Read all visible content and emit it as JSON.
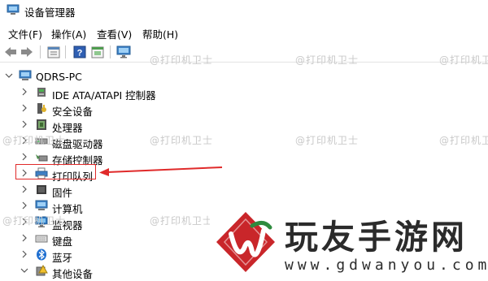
{
  "window": {
    "title": "设备管理器"
  },
  "menu": [
    "文件(F)",
    "操作(A)",
    "查看(V)",
    "帮助(H)"
  ],
  "toolbar": [
    "back-icon",
    "forward-icon",
    "properties-icon",
    "help-icon",
    "refresh-icon",
    "monitor-icon"
  ],
  "tree": {
    "root": "QDRS-PC",
    "items": [
      {
        "label": "IDE ATA/ATAPI 控制器",
        "icon": "ide-controller-icon"
      },
      {
        "label": "安全设备",
        "icon": "security-device-icon"
      },
      {
        "label": "处理器",
        "icon": "processor-icon"
      },
      {
        "label": "磁盘驱动器",
        "icon": "disk-drive-icon"
      },
      {
        "label": "存储控制器",
        "icon": "storage-controller-icon"
      },
      {
        "label": "打印队列",
        "icon": "printer-icon"
      },
      {
        "label": "固件",
        "icon": "firmware-icon"
      },
      {
        "label": "计算机",
        "icon": "computer-icon"
      },
      {
        "label": "监视器",
        "icon": "monitor-icon"
      },
      {
        "label": "键盘",
        "icon": "keyboard-icon"
      },
      {
        "label": "蓝牙",
        "icon": "bluetooth-icon"
      },
      {
        "label": "其他设备",
        "icon": "other-devices-icon"
      }
    ]
  },
  "watermark": "@打印机卫士",
  "brand": {
    "name": "玩友手游网",
    "url": "www.gdwanyou.com"
  },
  "colors": {
    "annotation": "#e02a2a",
    "brand_logo": "#c9262a"
  }
}
